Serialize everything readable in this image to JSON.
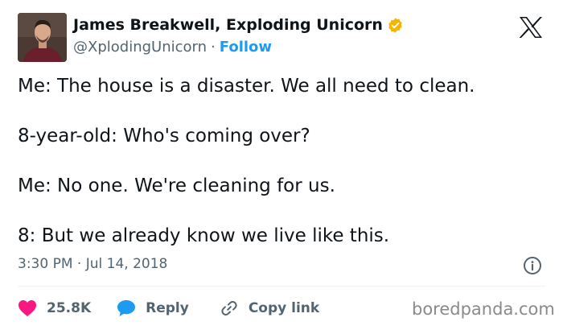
{
  "author": {
    "display_name": "James Breakwell, Exploding Unicorn",
    "handle": "@XplodingUnicorn",
    "separator": "·",
    "follow_label": "Follow",
    "verified_color": "#f4b400"
  },
  "tweet": {
    "lines": [
      "Me: The house is a disaster. We all need to clean.",
      "8-year-old: Who's coming over?",
      "Me: No one. We're cleaning for us.",
      "8: But we already know we live like this."
    ],
    "timestamp": "3:30 PM · Jul 14, 2018"
  },
  "actions": {
    "like_count": "25.8K",
    "reply_label": "Reply",
    "copy_link_label": "Copy link"
  },
  "icons": {
    "avatar": "profile-photo",
    "verified": "verified-badge-icon",
    "x_logo": "x-logo-icon",
    "info": "info-icon",
    "like": "heart-icon",
    "reply": "speech-bubble-icon",
    "copy_link": "link-icon"
  },
  "colors": {
    "text": "#0f1419",
    "secondary": "#536471",
    "link": "#1d9bf0",
    "like": "#f91880",
    "reply": "#1d9bf0",
    "watermark": "#8a8a8a"
  },
  "watermark": "boredpanda.com"
}
